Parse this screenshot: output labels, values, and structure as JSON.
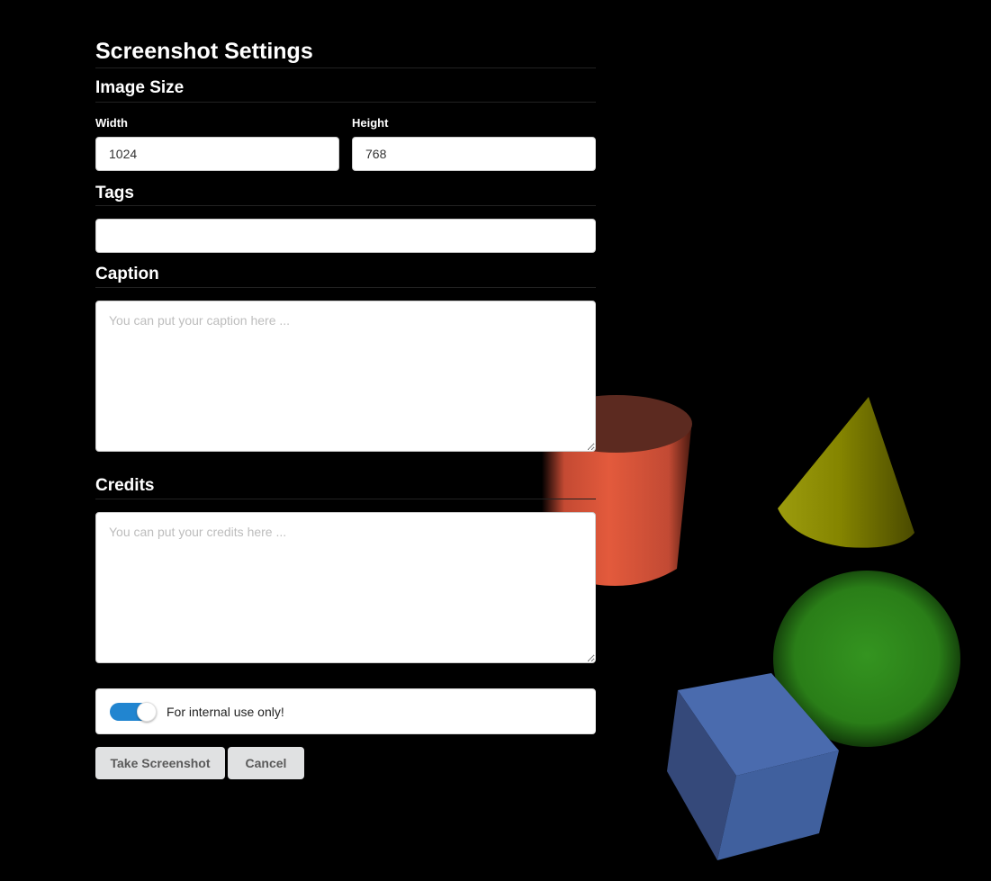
{
  "dialog": {
    "title": "Screenshot Settings",
    "image_size": {
      "heading": "Image Size",
      "width_label": "Width",
      "width_value": "1024",
      "height_label": "Height",
      "height_value": "768"
    },
    "tags": {
      "heading": "Tags",
      "value": ""
    },
    "caption": {
      "heading": "Caption",
      "placeholder": "You can put your caption here ..."
    },
    "credits": {
      "heading": "Credits",
      "placeholder": "You can put your credits here ..."
    },
    "internal_toggle": {
      "label": "For internal use only!",
      "checked": true,
      "color": "#2185d0"
    },
    "buttons": {
      "take_screenshot": "Take Screenshot",
      "cancel": "Cancel"
    }
  },
  "scene": {
    "background": "#000000",
    "objects": [
      {
        "name": "cylinder",
        "color": "#e0553a"
      },
      {
        "name": "cone",
        "color": "#8a8a00"
      },
      {
        "name": "sphere",
        "color": "#2f8a1a"
      },
      {
        "name": "cube",
        "color": "#4566a8"
      }
    ]
  }
}
